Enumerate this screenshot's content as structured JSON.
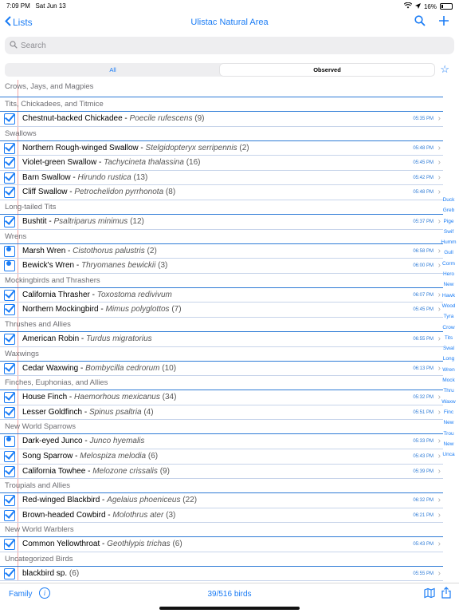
{
  "status": {
    "time": "7:09 PM",
    "date": "Sat Jun 13",
    "battery": "16%"
  },
  "nav": {
    "back_label": "Lists",
    "title": "Ulistac Natural Area"
  },
  "search": {
    "placeholder": "Search"
  },
  "segment": {
    "all": "All",
    "observed": "Observed"
  },
  "sections": [
    {
      "name": "Crows, Jays, and Magpies",
      "clipped": true,
      "rows": []
    },
    {
      "name": "Tits, Chickadees, and Titmice",
      "rows": [
        {
          "common": "Chestnut-backed Chickadee",
          "sci": "Poecile rufescens",
          "count": "(9)",
          "time": "05:35 PM",
          "mark": "check"
        }
      ]
    },
    {
      "name": "Swallows",
      "rows": [
        {
          "common": "Northern Rough-winged Swallow",
          "sci": "Stelgidopteryx serripennis",
          "count": "(2)",
          "time": "05:48 PM",
          "mark": "check"
        },
        {
          "common": "Violet-green Swallow",
          "sci": "Tachycineta thalassina",
          "count": "(16)",
          "time": "05:45 PM",
          "mark": "check"
        },
        {
          "common": "Barn Swallow",
          "sci": "Hirundo rustica",
          "count": "(13)",
          "time": "05:42 PM",
          "mark": "check"
        },
        {
          "common": "Cliff Swallow",
          "sci": "Petrochelidon pyrrhonota",
          "count": "(8)",
          "time": "05:48 PM",
          "mark": "check"
        }
      ]
    },
    {
      "name": "Long-tailed Tits",
      "rows": [
        {
          "common": "Bushtit",
          "sci": "Psaltriparus minimus",
          "count": "(12)",
          "time": "05:37 PM",
          "mark": "check"
        }
      ]
    },
    {
      "name": "Wrens",
      "rows": [
        {
          "common": "Marsh Wren",
          "sci": "Cistothorus palustris",
          "count": "(2)",
          "time": "06:58 PM",
          "mark": "note"
        },
        {
          "common": "Bewick's Wren",
          "sci": "Thryomanes bewickii",
          "count": "(3)",
          "time": "06:00 PM",
          "mark": "note"
        }
      ]
    },
    {
      "name": "Mockingbirds and Thrashers",
      "rows": [
        {
          "common": "California Thrasher",
          "sci": "Toxostoma redivivum",
          "count": "",
          "time": "06:07 PM",
          "mark": "check"
        },
        {
          "common": "Northern Mockingbird",
          "sci": "Mimus polyglottos",
          "count": "(7)",
          "time": "05:45 PM",
          "mark": "check"
        }
      ]
    },
    {
      "name": "Thrushes and Allies",
      "rows": [
        {
          "common": "American Robin",
          "sci": "Turdus migratorius",
          "count": "",
          "time": "06:55 PM",
          "mark": "check"
        }
      ]
    },
    {
      "name": "Waxwings",
      "rows": [
        {
          "common": "Cedar Waxwing",
          "sci": "Bombycilla cedrorum",
          "count": "(10)",
          "time": "06:13 PM",
          "mark": "check"
        }
      ]
    },
    {
      "name": "Finches, Euphonias, and Allies",
      "rows": [
        {
          "common": "House Finch",
          "sci": "Haemorhous mexicanus",
          "count": "(34)",
          "time": "05:32 PM",
          "mark": "check"
        },
        {
          "common": "Lesser Goldfinch",
          "sci": "Spinus psaltria",
          "count": "(4)",
          "time": "05:51 PM",
          "mark": "check"
        }
      ]
    },
    {
      "name": "New World Sparrows",
      "rows": [
        {
          "common": "Dark-eyed Junco",
          "sci": "Junco hyemalis",
          "count": "",
          "time": "05:33 PM",
          "mark": "note"
        },
        {
          "common": "Song Sparrow",
          "sci": "Melospiza melodia",
          "count": "(6)",
          "time": "05:43 PM",
          "mark": "check"
        },
        {
          "common": "California Towhee",
          "sci": "Melozone crissalis",
          "count": "(9)",
          "time": "05:39 PM",
          "mark": "check"
        }
      ]
    },
    {
      "name": "Troupials and Allies",
      "rows": [
        {
          "common": "Red-winged Blackbird",
          "sci": "Agelaius phoeniceus",
          "count": "(22)",
          "time": "06:32 PM",
          "mark": "check"
        },
        {
          "common": "Brown-headed Cowbird",
          "sci": "Molothrus ater",
          "count": "(3)",
          "time": "06:21 PM",
          "mark": "check"
        }
      ]
    },
    {
      "name": "New World Warblers",
      "rows": [
        {
          "common": "Common Yellowthroat",
          "sci": "Geothlypis trichas",
          "count": "(6)",
          "time": "05:43 PM",
          "mark": "check"
        }
      ]
    },
    {
      "name": "Uncategorized Birds",
      "rows": [
        {
          "common": "blackbird sp.",
          "sci": "",
          "count": "(6)",
          "time": "05:55 PM",
          "mark": "check"
        }
      ]
    }
  ],
  "index": [
    "Duck",
    "Greb",
    "Pige",
    "Swif",
    "Humm",
    "Gull",
    "Corm",
    "Hero",
    "New",
    "Hawk",
    "Wood",
    "Tyra",
    "Crow",
    "Tits",
    "Swal",
    "Long",
    "Wren",
    "Mock",
    "Thru",
    "Waxw",
    "Finc",
    "New",
    "Trou",
    "New",
    "Unca"
  ],
  "toolbar": {
    "family_label": "Family",
    "info_glyph": "i",
    "count_label": "39/516 birds"
  },
  "colors": {
    "accent": "#1a7cf5",
    "section_line": "#2e7bd6"
  }
}
